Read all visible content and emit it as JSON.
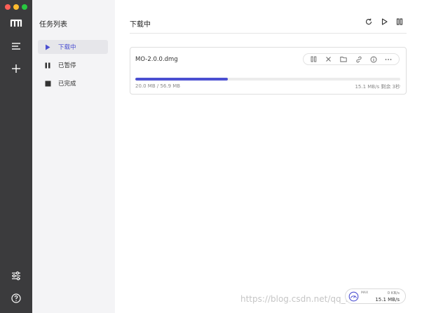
{
  "window": {
    "traffic_lights": [
      "close",
      "minimize",
      "zoom"
    ]
  },
  "rail": {
    "icons": [
      "app-logo-icon",
      "task-list-icon",
      "add-task-icon",
      "preferences-icon",
      "help-icon"
    ]
  },
  "sidebar": {
    "title": "任务列表",
    "items": [
      {
        "label": "下载中",
        "icon": "play-icon",
        "active": true
      },
      {
        "label": "已暂停",
        "icon": "pause-icon",
        "active": false
      },
      {
        "label": "已完成",
        "icon": "stop-icon",
        "active": false
      }
    ]
  },
  "main": {
    "title": "下载中",
    "header_actions": [
      "refresh-icon",
      "resume-all-icon",
      "pause-all-icon"
    ],
    "task": {
      "name": "MO-2.0.0.dmg",
      "size_text": "20.0 MB / 56.9 MB",
      "speed_text": "15.1 MB/s 剩余 3秒",
      "progress": 0.35,
      "actions": [
        "pause-icon",
        "delete-icon",
        "folder-icon",
        "link-icon",
        "info-icon",
        "more-icon"
      ]
    }
  },
  "speed_widget": {
    "max_label": "MAX",
    "upload": "0 KB/s",
    "download": "15.1 MB/s"
  },
  "watermark": "https://blog.csdn.net/qq_36347707",
  "colors": {
    "accent": "#4b4fd1",
    "rail_bg": "#3b3b3d",
    "sidebar_bg": "#f4f4f6"
  }
}
